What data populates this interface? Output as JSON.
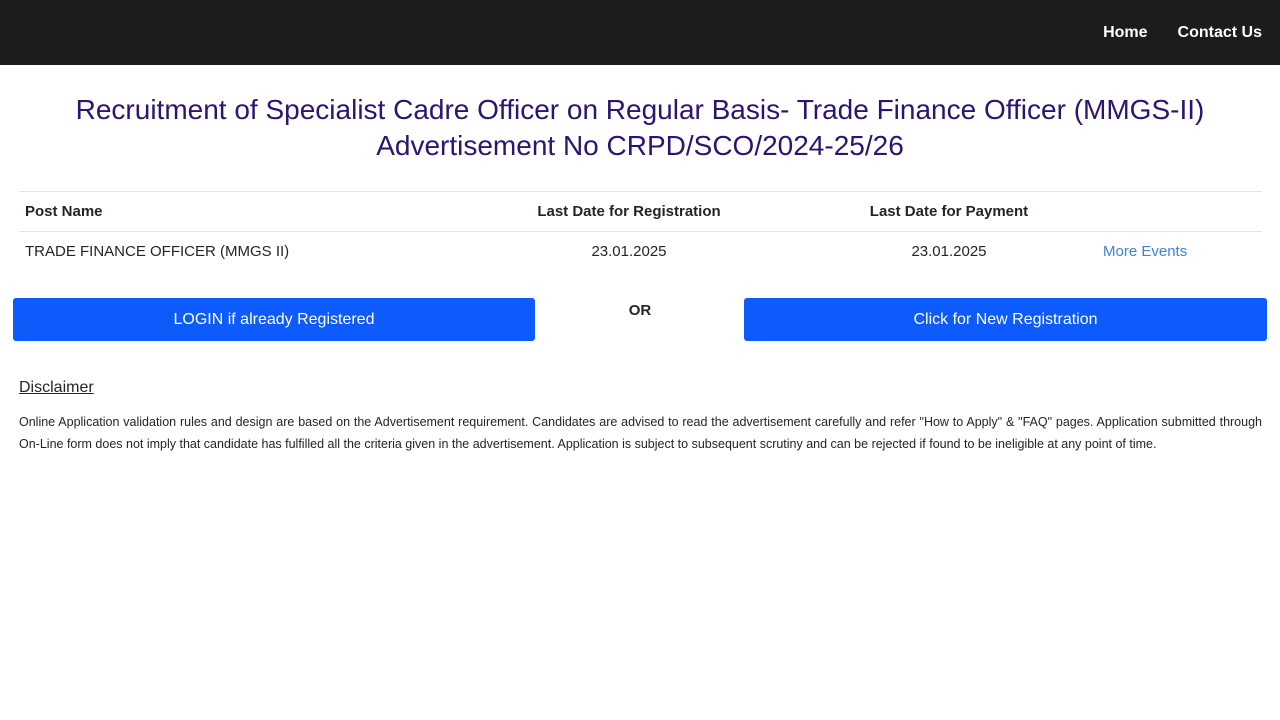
{
  "nav": {
    "home_label": "Home",
    "contact_label": "Contact Us"
  },
  "header": {
    "title_line1": "Recruitment of Specialist Cadre Officer on Regular Basis- Trade Finance Officer (MMGS-II)",
    "title_line2": "Advertisement No CRPD/SCO/2024-25/26"
  },
  "table": {
    "columns": [
      "Post Name",
      "Last Date for Registration",
      "Last Date for Payment"
    ],
    "rows": [
      {
        "post_name": "TRADE FINANCE OFFICER (MMGS II)",
        "registration_date": "23.01.2025",
        "payment_date": "23.01.2025",
        "action_label": "More Events"
      }
    ]
  },
  "actions": {
    "login_label": "LOGIN if already Registered",
    "or_label": "OR",
    "register_label": "Click for New Registration"
  },
  "disclaimer": {
    "title": "Disclaimer",
    "text": "Online Application validation rules and design are based on the Advertisement requirement. Candidates are advised to read the advertisement carefully and refer \"How to Apply\" & \"FAQ\" pages. Application submitted through On-Line form does not imply that candidate has fulfilled all the criteria given in the advertisement. Application is subject to subsequent scrutiny and can be rejected if found to be ineligible at any point of time."
  },
  "colors": {
    "topbar": "#1c1c1c",
    "title": "#2c1470",
    "button": "#0d5bfa",
    "link": "#3b82d9"
  }
}
